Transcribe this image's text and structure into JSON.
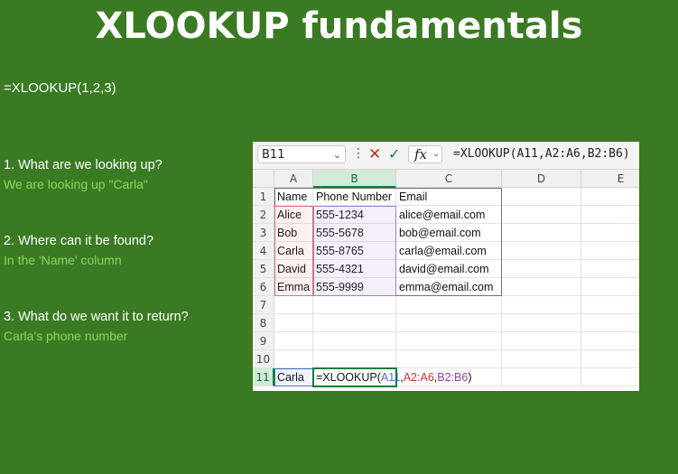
{
  "slide": {
    "title": "XLOOKUP fundamentals",
    "formula_intro": "=XLOOKUP(1,2,3)",
    "questions": [
      {
        "q": "1. What are we looking up?",
        "a": "We are looking up \"Carla\""
      },
      {
        "q": "2. Where can it be found?",
        "a": "In the 'Name' column"
      },
      {
        "q": "3. What do we want it to return?",
        "a": "Carla's phone number"
      }
    ]
  },
  "excel": {
    "name_box": "B11",
    "formula_bar": "=XLOOKUP(A11,A2:A6,B2:B6)",
    "icons": {
      "more": "vertical-dots-icon",
      "cancel": "x-icon",
      "enter": "checkmark-icon",
      "fx": "fx",
      "chevron": "chevron-down-icon"
    },
    "columns": [
      "A",
      "B",
      "C",
      "D",
      "E"
    ],
    "rows": [
      "1",
      "2",
      "3",
      "4",
      "5",
      "6",
      "7",
      "8",
      "9",
      "10",
      "11"
    ],
    "cells": [
      [
        "Name",
        "Phone Number",
        "Email"
      ],
      [
        "Alice",
        "555-1234",
        "alice@email.com"
      ],
      [
        "Bob",
        "555-5678",
        "bob@email.com"
      ],
      [
        "Carla",
        "555-8765",
        "carla@email.com"
      ],
      [
        "David",
        "555-4321",
        "david@email.com"
      ],
      [
        "Emma",
        "555-9999",
        "emma@email.com"
      ]
    ],
    "a11": "Carla",
    "b11_formula": {
      "prefix": "=XLOOKUP(",
      "arg1": "A11",
      "sep1": ",",
      "arg2": "A2:A6",
      "sep2": ",",
      "arg3": "B2:B6",
      "suffix": ")"
    },
    "colors": {
      "arg1": "#4472c4",
      "arg2": "#c0392b",
      "arg3": "#8e44ad",
      "accent": "#107c41"
    }
  }
}
